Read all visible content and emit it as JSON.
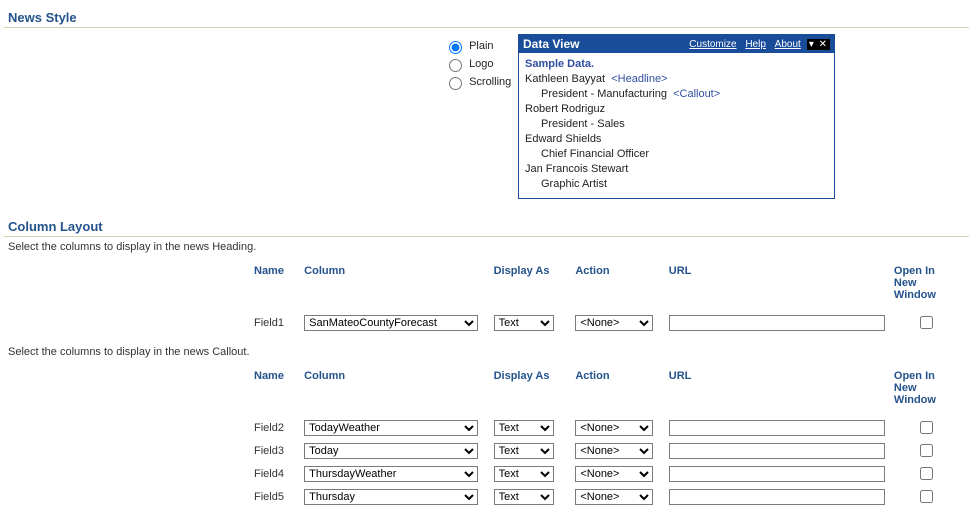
{
  "news_style": {
    "title": "News Style",
    "options": [
      {
        "label": "Plain",
        "checked": true
      },
      {
        "label": "Logo",
        "checked": false
      },
      {
        "label": "Scrolling",
        "checked": false
      }
    ]
  },
  "data_view": {
    "title": "Data View",
    "links": {
      "customize": "Customize",
      "help": "Help",
      "about": "About"
    },
    "sample_label": "Sample Data.",
    "rows": [
      {
        "name": "Kathleen Bayyat",
        "tag": "<Headline>",
        "role": "President - Manufacturing",
        "role_tag": "<Callout>"
      },
      {
        "name": "Robert Rodriguz",
        "tag": "",
        "role": "President - Sales",
        "role_tag": ""
      },
      {
        "name": "Edward Shields",
        "tag": "",
        "role": "Chief Financial Officer",
        "role_tag": ""
      },
      {
        "name": "Jan Francois Stewart",
        "tag": "",
        "role": "Graphic Artist",
        "role_tag": ""
      }
    ]
  },
  "column_layout": {
    "title": "Column Layout",
    "heading_instr": "Select the columns to display in the news Heading.",
    "callout_instr": "Select the columns to display in the news Callout.",
    "headers": {
      "name": "Name",
      "column": "Column",
      "display_as": "Display As",
      "action": "Action",
      "url": "URL",
      "open": "Open In New Window"
    },
    "heading_rows": [
      {
        "name": "Field1",
        "column": "SanMateoCountyForecast",
        "display_as": "Text",
        "action": "<None>",
        "url": "",
        "open": false
      }
    ],
    "callout_rows": [
      {
        "name": "Field2",
        "column": "TodayWeather",
        "display_as": "Text",
        "action": "<None>",
        "url": "",
        "open": false
      },
      {
        "name": "Field3",
        "column": "Today",
        "display_as": "Text",
        "action": "<None>",
        "url": "",
        "open": false
      },
      {
        "name": "Field4",
        "column": "ThursdayWeather",
        "display_as": "Text",
        "action": "<None>",
        "url": "",
        "open": false
      },
      {
        "name": "Field5",
        "column": "Thursday",
        "display_as": "Text",
        "action": "<None>",
        "url": "",
        "open": false
      }
    ]
  }
}
